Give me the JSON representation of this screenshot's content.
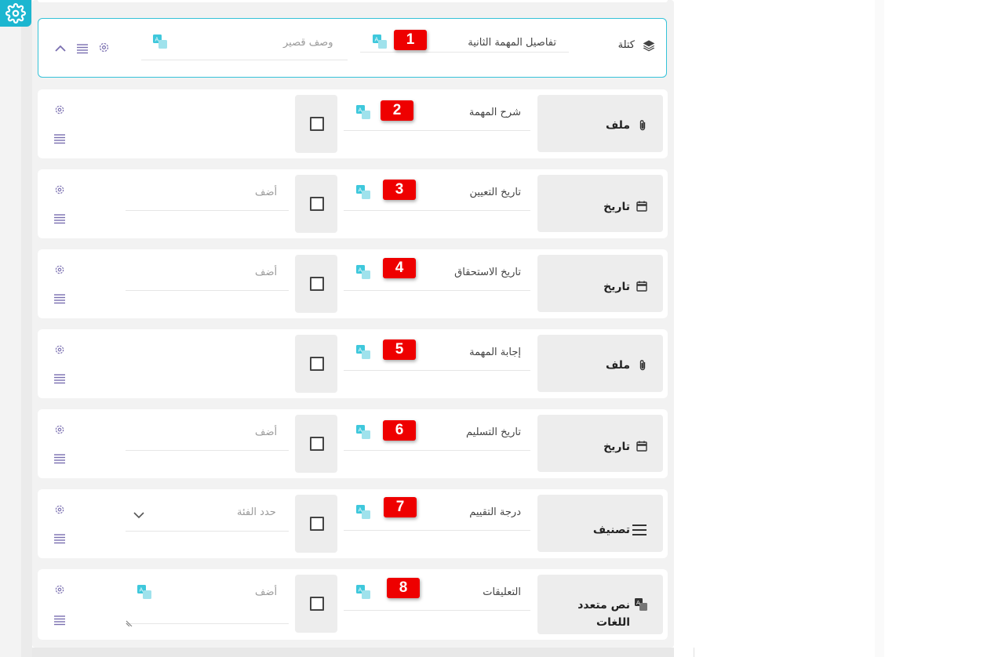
{
  "header_block": {
    "label": "كتلة",
    "title_value": "تفاصيل المهمة الثانية",
    "short_desc_placeholder": "وصف قصير",
    "badge": "1"
  },
  "rows": [
    {
      "type_label": "ملف",
      "type_icon": "paperclip-icon",
      "field_label": "شرح المهمة",
      "badge": "2",
      "value_placeholder": ""
    },
    {
      "type_label": "تاريخ",
      "type_icon": "calendar-icon",
      "field_label": "تاريخ التعيين",
      "badge": "3",
      "value_placeholder": "أضف"
    },
    {
      "type_label": "تاريخ",
      "type_icon": "calendar-icon",
      "field_label": "تاريخ الاستحقاق",
      "badge": "4",
      "value_placeholder": "أضف"
    },
    {
      "type_label": "ملف",
      "type_icon": "paperclip-icon",
      "field_label": "إجابة المهمة",
      "badge": "5",
      "value_placeholder": ""
    },
    {
      "type_label": "تاريخ",
      "type_icon": "calendar-icon",
      "field_label": "تاريخ التسليم",
      "badge": "6",
      "value_placeholder": "أضف"
    },
    {
      "type_label": "تصنيف",
      "type_icon": "menu-icon",
      "field_label": "درجة التقييم",
      "badge": "7",
      "value_placeholder": "حدد الفئة"
    },
    {
      "type_label": "نص متعدد اللغات",
      "type_icon": "translate-icon",
      "field_label": "التعليقات",
      "badge": "8",
      "value_placeholder": "أضف"
    }
  ],
  "colors": {
    "accent": "#1cb6d0",
    "badge": "#ee0000",
    "translate_icon": "#3fc8dc"
  }
}
